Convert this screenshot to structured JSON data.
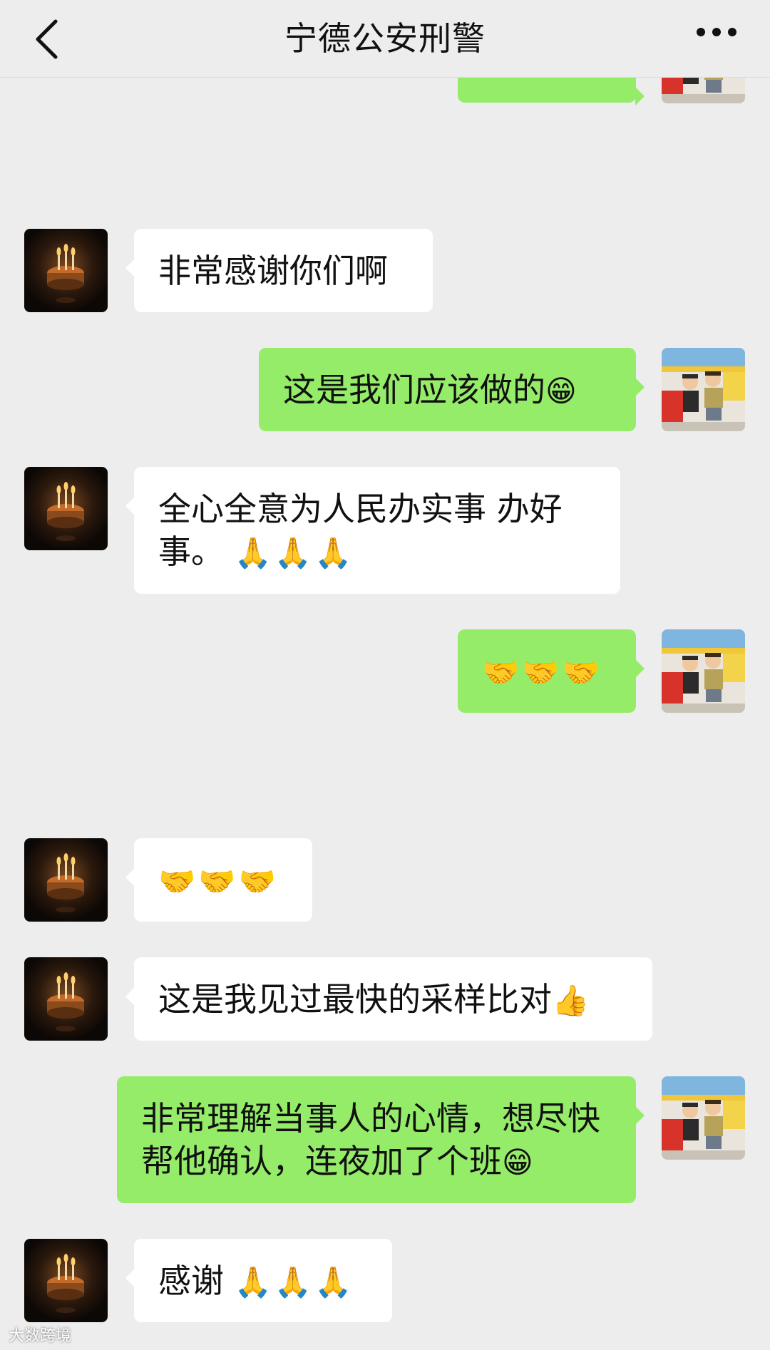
{
  "header": {
    "title": "宁德公安刑警",
    "back_icon": "chevron-left-icon",
    "more_icon": "more-dots-icon"
  },
  "colors": {
    "background": "#ededed",
    "incoming_bubble": "#ffffff",
    "outgoing_bubble": "#95ec69"
  },
  "messages": [
    {
      "direction": "outgoing",
      "text": "",
      "emoji": "",
      "partial": true
    },
    {
      "direction": "incoming",
      "text": "非常感谢你们啊",
      "emoji": ""
    },
    {
      "direction": "outgoing",
      "text": "这是我们应该做的",
      "emoji": "😁"
    },
    {
      "direction": "incoming",
      "text": "全心全意为人民办实事 办好事。",
      "emoji": "🙏🙏🙏"
    },
    {
      "direction": "outgoing",
      "text": "",
      "emoji": "🤝🤝🤝"
    },
    {
      "direction": "incoming",
      "text": "",
      "emoji": "🤝🤝🤝"
    },
    {
      "direction": "incoming",
      "text": "这是我见过最快的采样比对",
      "emoji": "👍"
    },
    {
      "direction": "outgoing",
      "text": "非常理解当事人的心情，想尽快帮他确认，连夜加了个班",
      "emoji": "😁"
    },
    {
      "direction": "incoming",
      "text": "感谢",
      "emoji": "🙏🙏🙏"
    }
  ],
  "avatars": {
    "incoming": "birthday-cake-avatar-icon",
    "outgoing": "children-photo-avatar-icon"
  },
  "watermark": "大数跨境"
}
